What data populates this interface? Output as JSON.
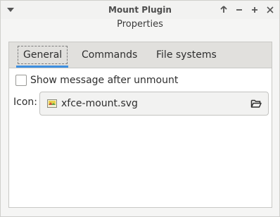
{
  "window": {
    "title": "Mount Plugin",
    "subtitle": "Properties",
    "controls": {
      "menu_icon": "window-menu-chevron-icon",
      "shade_icon": "arrow-up-icon",
      "minimize_icon": "minimize-icon",
      "maximize_icon": "maximize-plus-icon",
      "close_icon": "close-icon"
    }
  },
  "tabs": [
    {
      "label": "General",
      "active": true
    },
    {
      "label": "Commands",
      "active": false
    },
    {
      "label": "File systems",
      "active": false
    }
  ],
  "general": {
    "show_message_label": "Show message after unmount",
    "show_message_checked": false,
    "icon_label": "Icon:",
    "icon_file": "xfce-mount.svg",
    "file_icon": "image-file-icon",
    "open_icon": "folder-open-icon"
  },
  "colors": {
    "accent": "#3d8fe0"
  }
}
